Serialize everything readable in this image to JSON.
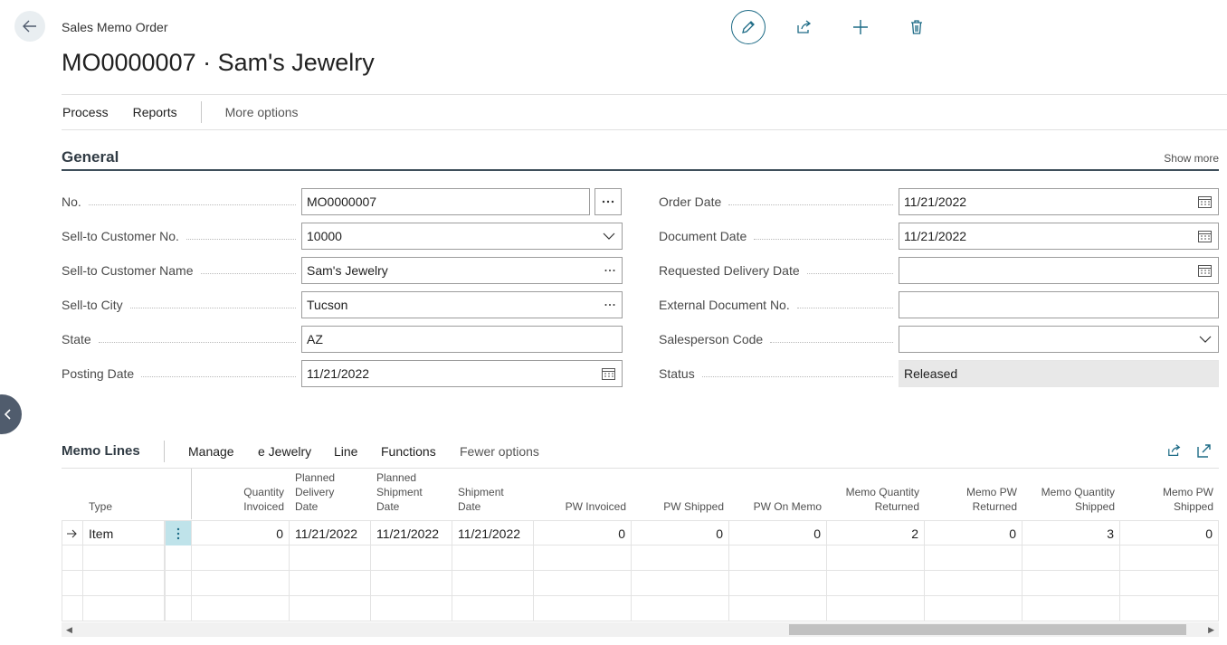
{
  "header": {
    "page_type": "Sales Memo Order",
    "title": "MO0000007 · Sam's Jewelry"
  },
  "actions": {
    "items": [
      "Process",
      "Reports"
    ],
    "more": "More options"
  },
  "general": {
    "title": "General",
    "show_more": "Show more",
    "left_fields": [
      {
        "label": "No.",
        "value": "MO0000007",
        "control": "assist-button"
      },
      {
        "label": "Sell-to Customer No.",
        "value": "10000",
        "control": "dropdown"
      },
      {
        "label": "Sell-to Customer Name",
        "value": "Sam's Jewelry",
        "control": "lookup"
      },
      {
        "label": "Sell-to City",
        "value": "Tucson",
        "control": "lookup"
      },
      {
        "label": "State",
        "value": "AZ",
        "control": "text"
      },
      {
        "label": "Posting Date",
        "value": "11/21/2022",
        "control": "date"
      }
    ],
    "right_fields": [
      {
        "label": "Order Date",
        "value": "11/21/2022",
        "control": "date"
      },
      {
        "label": "Document Date",
        "value": "11/21/2022",
        "control": "date"
      },
      {
        "label": "Requested Delivery Date",
        "value": "",
        "control": "date"
      },
      {
        "label": "External Document No.",
        "value": "",
        "control": "text"
      },
      {
        "label": "Salesperson Code",
        "value": "",
        "control": "dropdown"
      },
      {
        "label": "Status",
        "value": "Released",
        "control": "readonly"
      }
    ]
  },
  "lines": {
    "title": "Memo Lines",
    "menu": [
      "Manage",
      "e Jewelry",
      "Line",
      "Functions"
    ],
    "fewer": "Fewer options",
    "columns": [
      [
        "Type"
      ],
      [
        "Quantity",
        "Invoiced"
      ],
      [
        "Planned",
        "Delivery",
        "Date"
      ],
      [
        "Planned",
        "Shipment",
        "Date"
      ],
      [
        "Shipment",
        "Date"
      ],
      [
        "PW Invoiced"
      ],
      [
        "PW Shipped"
      ],
      [
        "PW On Memo"
      ],
      [
        "Memo Quantity",
        "Returned"
      ],
      [
        "Memo PW",
        "Returned"
      ],
      [
        "Memo Quantity",
        "Shipped"
      ],
      [
        "Memo PW",
        "Shipped"
      ]
    ],
    "rows": [
      [
        "Item",
        "0",
        "11/21/2022",
        "11/21/2022",
        "11/21/2022",
        "0",
        "0",
        "0",
        "2",
        "0",
        "3",
        "0"
      ]
    ]
  },
  "colors": {
    "accent": "#1d6b86",
    "section_rule": "#3f4f5b",
    "selected_cell": "#bfe3ea"
  }
}
